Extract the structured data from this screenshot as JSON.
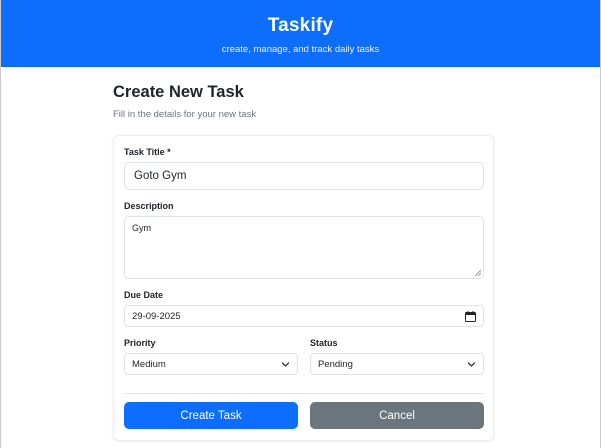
{
  "header": {
    "title": "Taskify",
    "tagline": "create, manage, and track daily tasks"
  },
  "page": {
    "title": "Create New Task",
    "subtitle": "Fill in the details for your new task"
  },
  "form": {
    "task_title": {
      "label": "Task Title *",
      "value": "Goto Gym"
    },
    "description": {
      "label": "Description",
      "value": "Gym"
    },
    "due_date": {
      "label": "Due Date",
      "value": "29-09-2025",
      "icon": "calendar-icon"
    },
    "priority": {
      "label": "Priority",
      "value": "Medium",
      "icon": "chevron-down-icon"
    },
    "status": {
      "label": "Status",
      "value": "Pending",
      "icon": "chevron-down-icon"
    }
  },
  "actions": {
    "create_label": "Create Task",
    "cancel_label": "Cancel"
  },
  "colors": {
    "primary": "#0d6efd",
    "secondary": "#6c757d",
    "muted_text": "#6c757d"
  }
}
